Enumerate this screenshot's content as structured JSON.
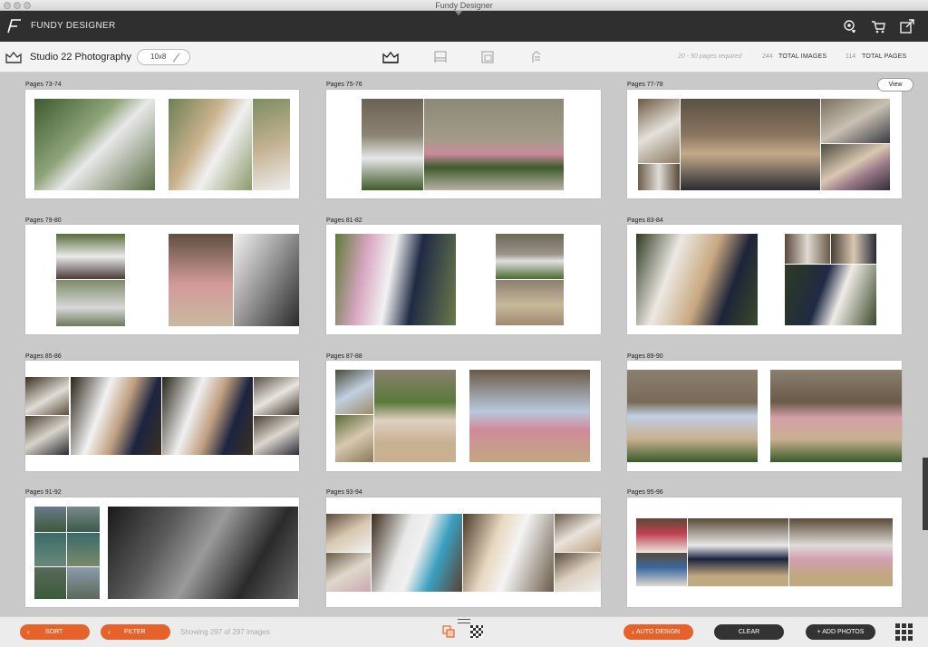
{
  "window": {
    "title": "Fundy Designer"
  },
  "header": {
    "app_name": "FUNDY DESIGNER"
  },
  "toolbar": {
    "studio_name": "Studio 22 Photography",
    "album_size": "10x8",
    "pages_required": "20 - 50 pages required",
    "total_images_count": "244",
    "total_images_label": "TOTAL IMAGES",
    "total_pages_count": "114",
    "total_pages_label": "TOTAL PAGES"
  },
  "view_button": "View",
  "spreads": [
    "Pages 73-74",
    "Pages 75-76",
    "Pages 77-78",
    "Pages 79-80",
    "Pages 81-82",
    "Pages 83-84",
    "Pages 85-86",
    "Pages 87-88",
    "Pages 89-90",
    "Pages 91-92",
    "Pages 93-94",
    "Pages 95-96"
  ],
  "bottom": {
    "sort_label": "SORT",
    "filter_label": "FILTER",
    "showing_text": "Showing 297 of 297 images",
    "auto_design_label": "AUTO DESIGN",
    "clear_label": "CLEAR",
    "add_photos_label": "+ ADD PHOTOS"
  },
  "colors": {
    "accent": "#e5632a",
    "header_bg": "#2f2f2f",
    "canvas_bg": "#c9c9c9"
  },
  "icons": [
    "window-close-icon",
    "window-minimize-icon",
    "window-maximize-icon",
    "fundy-logo-icon",
    "cart-settings-icon",
    "cart-icon",
    "export-icon",
    "album-icon",
    "pencil-icon",
    "album-design-icon",
    "wall-art-icon",
    "card-icon",
    "proofing-icon",
    "stacked-photos-icon",
    "checker-icon",
    "grid-view-icon"
  ]
}
